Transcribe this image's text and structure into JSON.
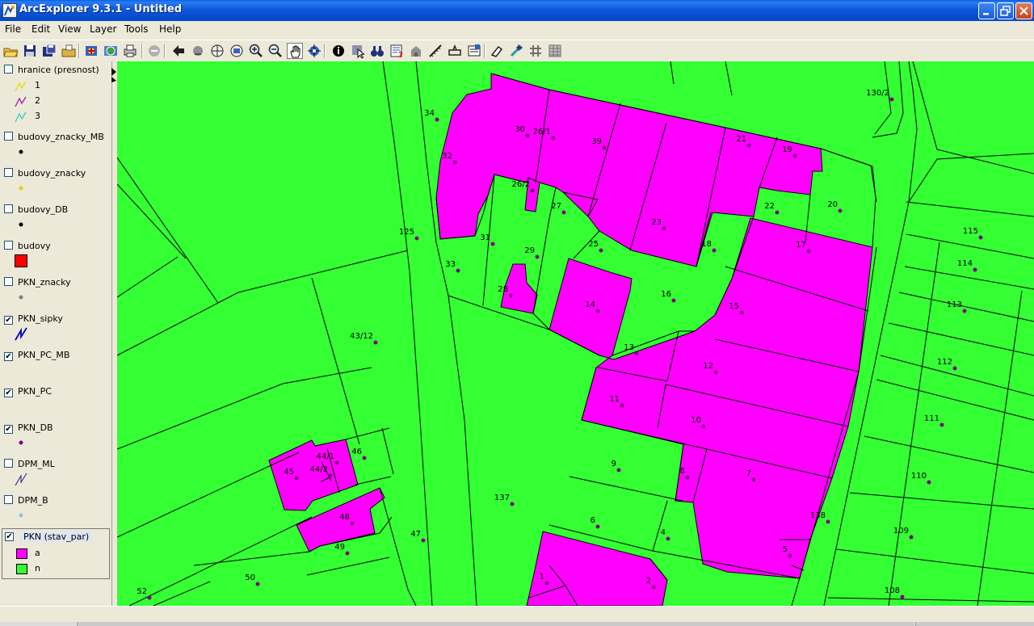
{
  "window": {
    "title": "ArcExplorer 9.3.1 - Untitled"
  },
  "menu": [
    "File",
    "Edit",
    "View",
    "Layer",
    "Tools",
    "Help"
  ],
  "toolbar": [
    {
      "name": "open-icon"
    },
    {
      "name": "save-icon"
    },
    {
      "name": "save-as-icon"
    },
    {
      "name": "open-folder-icon"
    },
    {
      "name": "add-data-icon"
    },
    {
      "name": "add-internet-data-icon"
    },
    {
      "name": "print-icon"
    },
    {
      "name": "stop-icon"
    },
    {
      "name": "back-extent-icon"
    },
    {
      "name": "forward-extent-icon"
    },
    {
      "name": "full-extent-icon"
    },
    {
      "name": "zoom-layer-icon"
    },
    {
      "name": "zoom-in-icon"
    },
    {
      "name": "zoom-out-icon"
    },
    {
      "name": "pan-hand-icon"
    },
    {
      "name": "continuous-pan-icon"
    },
    {
      "name": "identify-icon"
    },
    {
      "name": "select-icon"
    },
    {
      "name": "find-binoculars-icon"
    },
    {
      "name": "query-icon"
    },
    {
      "name": "locate-address-icon"
    },
    {
      "name": "measure-icon"
    },
    {
      "name": "buffer-icon"
    },
    {
      "name": "properties-icon"
    },
    {
      "name": "clear-selection-icon"
    },
    {
      "name": "hyperlink-icon"
    },
    {
      "name": "graticule-icon"
    },
    {
      "name": "table-icon"
    }
  ],
  "legend": {
    "layers": [
      {
        "name": "hranice (presnost)",
        "checked": false,
        "classes": [
          {
            "label": "1",
            "color": "#e8e000"
          },
          {
            "label": "2",
            "color": "#a020a0"
          },
          {
            "label": "3",
            "color": "#40c8c8"
          }
        ]
      },
      {
        "name": "budovy_znacky_MB",
        "checked": false,
        "symbol": "point",
        "color": "#000000"
      },
      {
        "name": "budovy_znacky",
        "checked": false,
        "symbol": "point",
        "color": "#e8d000"
      },
      {
        "name": "budovy_DB",
        "checked": false,
        "symbol": "point",
        "color": "#000000"
      },
      {
        "name": "budovy",
        "checked": false,
        "symbol": "fill",
        "color": "#ff0000"
      },
      {
        "name": "PKN_znacky",
        "checked": false,
        "symbol": "point",
        "color": "#808080"
      },
      {
        "name": "PKN_sipky",
        "checked": true,
        "symbol": "line",
        "color": "#0000c0"
      },
      {
        "name": "PKN_PC_MB",
        "checked": true,
        "symbol": "none"
      },
      {
        "name": "PKN_PC",
        "checked": true,
        "symbol": "none"
      },
      {
        "name": "PKN_DB",
        "checked": true,
        "symbol": "point",
        "color": "#800080"
      },
      {
        "name": "DPM_ML",
        "checked": false,
        "symbol": "line",
        "color": "#202080"
      },
      {
        "name": "DPM_B",
        "checked": false,
        "symbol": "point",
        "color": "#80c8e0"
      }
    ],
    "active_layer": {
      "name": "PKN (stav_par)",
      "checked": true,
      "classes": [
        {
          "label": "a",
          "color": "#ff00ff"
        },
        {
          "label": "n",
          "color": "#33ff33"
        }
      ]
    }
  },
  "map": {
    "colors": {
      "parcel_a": "#ff00ff",
      "parcel_n": "#33ff33",
      "outline": "#000000",
      "point": "#800080"
    },
    "parcel_labels": [
      "34",
      "30",
      "26/1",
      "39",
      "21",
      "19",
      "130/2",
      "32",
      "26/2",
      "27",
      "20",
      "22",
      "23",
      "125",
      "31",
      "25",
      "18",
      "17",
      "115",
      "33",
      "29",
      "114",
      "28",
      "14",
      "16",
      "15",
      "113",
      "43/12",
      "13",
      "12",
      "112",
      "11",
      "10",
      "111",
      "46",
      "44/1",
      "45",
      "44/2",
      "9",
      "8",
      "7",
      "110",
      "137",
      "48",
      "6",
      "138",
      "47",
      "4",
      "109",
      "49",
      "5",
      "50",
      "1",
      "2",
      "52",
      "108"
    ]
  }
}
